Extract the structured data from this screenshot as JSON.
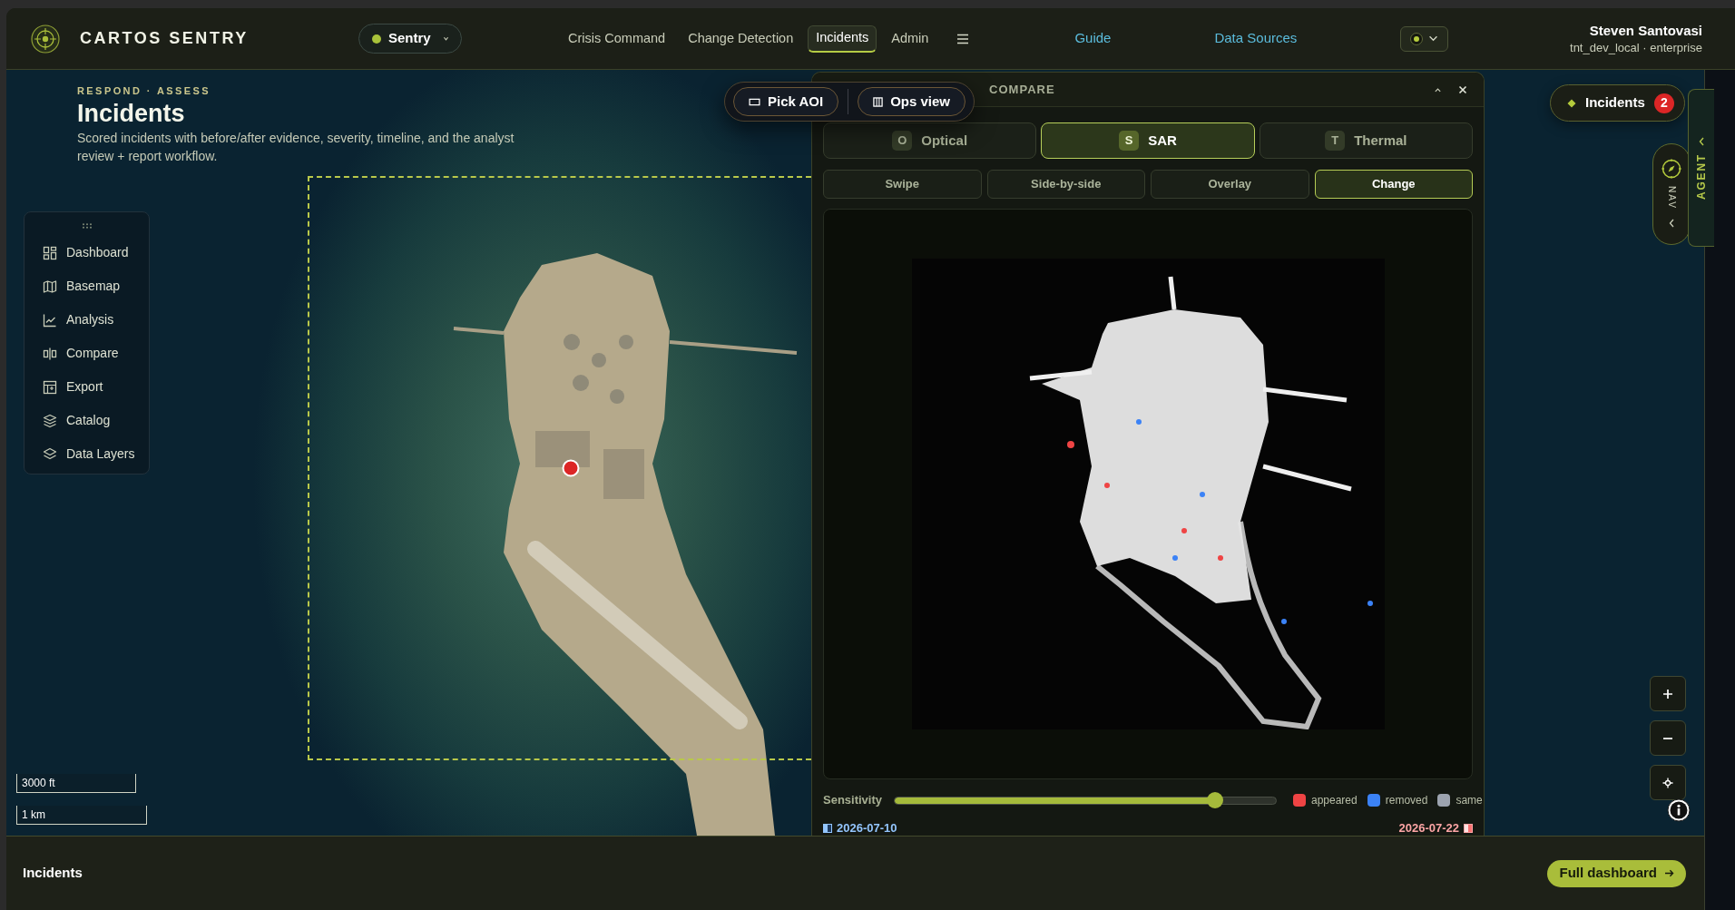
{
  "header": {
    "brand": "CARTOS SENTRY",
    "workspace": {
      "label": "Sentry"
    },
    "nav": [
      {
        "label": "Crisis Command",
        "selected": false
      },
      {
        "label": "Change Detection",
        "selected": false
      },
      {
        "label": "Incidents",
        "selected": true
      },
      {
        "label": "Admin",
        "selected": false
      }
    ],
    "links": [
      {
        "label": "Guide"
      },
      {
        "label": "Data Sources"
      }
    ],
    "user": {
      "name": "Steven Santovasi",
      "subtitle": "tnt_dev_local · enterprise"
    }
  },
  "page": {
    "eyebrow": "RESPOND · ASSESS",
    "title": "Incidents",
    "description": "Scored incidents with before/after evidence, severity, timeline, and the analyst review + report workflow."
  },
  "sidebar": {
    "items": [
      {
        "label": "Dashboard",
        "selected": false
      },
      {
        "label": "Basemap",
        "selected": false
      },
      {
        "label": "Analysis",
        "selected": false
      },
      {
        "label": "Compare",
        "selected": false
      },
      {
        "label": "Export",
        "selected": false
      },
      {
        "label": "Catalog",
        "selected": false
      },
      {
        "label": "Data Layers",
        "selected": false
      }
    ]
  },
  "map": {
    "toolbar": [
      {
        "label": "Pick AOI"
      },
      {
        "label": "Ops view"
      }
    ],
    "scale_bars": [
      "3000 ft",
      "1 km"
    ]
  },
  "compare_panel": {
    "title": "COMPARE",
    "sensors": [
      {
        "initial": "O",
        "label": "Optical",
        "selected": false
      },
      {
        "initial": "S",
        "label": "SAR",
        "selected": true
      },
      {
        "initial": "T",
        "label": "Thermal",
        "selected": false
      }
    ],
    "modes": [
      {
        "label": "Swipe",
        "selected": false
      },
      {
        "label": "Side-by-side",
        "selected": false
      },
      {
        "label": "Overlay",
        "selected": false
      },
      {
        "label": "Change",
        "selected": true
      }
    ],
    "sensitivity": {
      "label": "Sensitivity",
      "level": 0.84
    },
    "legend": [
      {
        "label": "appeared",
        "color": "#ef4444"
      },
      {
        "label": "removed",
        "color": "#3b82f6"
      },
      {
        "label": "same",
        "color": "#9ca3af"
      }
    ],
    "dates": {
      "before": "2026-07-10",
      "after": "2026-07-22"
    }
  },
  "incidents_pill": {
    "label": "Incidents",
    "count": "2"
  },
  "nav_tab": {
    "label": "NAV"
  },
  "agent_tab": {
    "label": "AGENT"
  },
  "footer": {
    "title": "Incidents",
    "button": "Full dashboard"
  }
}
